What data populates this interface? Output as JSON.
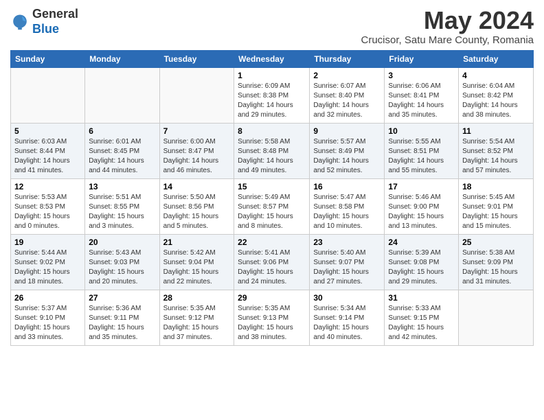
{
  "logo": {
    "general": "General",
    "blue": "Blue"
  },
  "title": "May 2024",
  "subtitle": "Crucisor, Satu Mare County, Romania",
  "days_of_week": [
    "Sunday",
    "Monday",
    "Tuesday",
    "Wednesday",
    "Thursday",
    "Friday",
    "Saturday"
  ],
  "weeks": [
    [
      {
        "num": "",
        "info": ""
      },
      {
        "num": "",
        "info": ""
      },
      {
        "num": "",
        "info": ""
      },
      {
        "num": "1",
        "info": "Sunrise: 6:09 AM\nSunset: 8:38 PM\nDaylight: 14 hours\nand 29 minutes."
      },
      {
        "num": "2",
        "info": "Sunrise: 6:07 AM\nSunset: 8:40 PM\nDaylight: 14 hours\nand 32 minutes."
      },
      {
        "num": "3",
        "info": "Sunrise: 6:06 AM\nSunset: 8:41 PM\nDaylight: 14 hours\nand 35 minutes."
      },
      {
        "num": "4",
        "info": "Sunrise: 6:04 AM\nSunset: 8:42 PM\nDaylight: 14 hours\nand 38 minutes."
      }
    ],
    [
      {
        "num": "5",
        "info": "Sunrise: 6:03 AM\nSunset: 8:44 PM\nDaylight: 14 hours\nand 41 minutes."
      },
      {
        "num": "6",
        "info": "Sunrise: 6:01 AM\nSunset: 8:45 PM\nDaylight: 14 hours\nand 44 minutes."
      },
      {
        "num": "7",
        "info": "Sunrise: 6:00 AM\nSunset: 8:47 PM\nDaylight: 14 hours\nand 46 minutes."
      },
      {
        "num": "8",
        "info": "Sunrise: 5:58 AM\nSunset: 8:48 PM\nDaylight: 14 hours\nand 49 minutes."
      },
      {
        "num": "9",
        "info": "Sunrise: 5:57 AM\nSunset: 8:49 PM\nDaylight: 14 hours\nand 52 minutes."
      },
      {
        "num": "10",
        "info": "Sunrise: 5:55 AM\nSunset: 8:51 PM\nDaylight: 14 hours\nand 55 minutes."
      },
      {
        "num": "11",
        "info": "Sunrise: 5:54 AM\nSunset: 8:52 PM\nDaylight: 14 hours\nand 57 minutes."
      }
    ],
    [
      {
        "num": "12",
        "info": "Sunrise: 5:53 AM\nSunset: 8:53 PM\nDaylight: 15 hours\nand 0 minutes."
      },
      {
        "num": "13",
        "info": "Sunrise: 5:51 AM\nSunset: 8:55 PM\nDaylight: 15 hours\nand 3 minutes."
      },
      {
        "num": "14",
        "info": "Sunrise: 5:50 AM\nSunset: 8:56 PM\nDaylight: 15 hours\nand 5 minutes."
      },
      {
        "num": "15",
        "info": "Sunrise: 5:49 AM\nSunset: 8:57 PM\nDaylight: 15 hours\nand 8 minutes."
      },
      {
        "num": "16",
        "info": "Sunrise: 5:47 AM\nSunset: 8:58 PM\nDaylight: 15 hours\nand 10 minutes."
      },
      {
        "num": "17",
        "info": "Sunrise: 5:46 AM\nSunset: 9:00 PM\nDaylight: 15 hours\nand 13 minutes."
      },
      {
        "num": "18",
        "info": "Sunrise: 5:45 AM\nSunset: 9:01 PM\nDaylight: 15 hours\nand 15 minutes."
      }
    ],
    [
      {
        "num": "19",
        "info": "Sunrise: 5:44 AM\nSunset: 9:02 PM\nDaylight: 15 hours\nand 18 minutes."
      },
      {
        "num": "20",
        "info": "Sunrise: 5:43 AM\nSunset: 9:03 PM\nDaylight: 15 hours\nand 20 minutes."
      },
      {
        "num": "21",
        "info": "Sunrise: 5:42 AM\nSunset: 9:04 PM\nDaylight: 15 hours\nand 22 minutes."
      },
      {
        "num": "22",
        "info": "Sunrise: 5:41 AM\nSunset: 9:06 PM\nDaylight: 15 hours\nand 24 minutes."
      },
      {
        "num": "23",
        "info": "Sunrise: 5:40 AM\nSunset: 9:07 PM\nDaylight: 15 hours\nand 27 minutes."
      },
      {
        "num": "24",
        "info": "Sunrise: 5:39 AM\nSunset: 9:08 PM\nDaylight: 15 hours\nand 29 minutes."
      },
      {
        "num": "25",
        "info": "Sunrise: 5:38 AM\nSunset: 9:09 PM\nDaylight: 15 hours\nand 31 minutes."
      }
    ],
    [
      {
        "num": "26",
        "info": "Sunrise: 5:37 AM\nSunset: 9:10 PM\nDaylight: 15 hours\nand 33 minutes."
      },
      {
        "num": "27",
        "info": "Sunrise: 5:36 AM\nSunset: 9:11 PM\nDaylight: 15 hours\nand 35 minutes."
      },
      {
        "num": "28",
        "info": "Sunrise: 5:35 AM\nSunset: 9:12 PM\nDaylight: 15 hours\nand 37 minutes."
      },
      {
        "num": "29",
        "info": "Sunrise: 5:35 AM\nSunset: 9:13 PM\nDaylight: 15 hours\nand 38 minutes."
      },
      {
        "num": "30",
        "info": "Sunrise: 5:34 AM\nSunset: 9:14 PM\nDaylight: 15 hours\nand 40 minutes."
      },
      {
        "num": "31",
        "info": "Sunrise: 5:33 AM\nSunset: 9:15 PM\nDaylight: 15 hours\nand 42 minutes."
      },
      {
        "num": "",
        "info": ""
      }
    ]
  ]
}
